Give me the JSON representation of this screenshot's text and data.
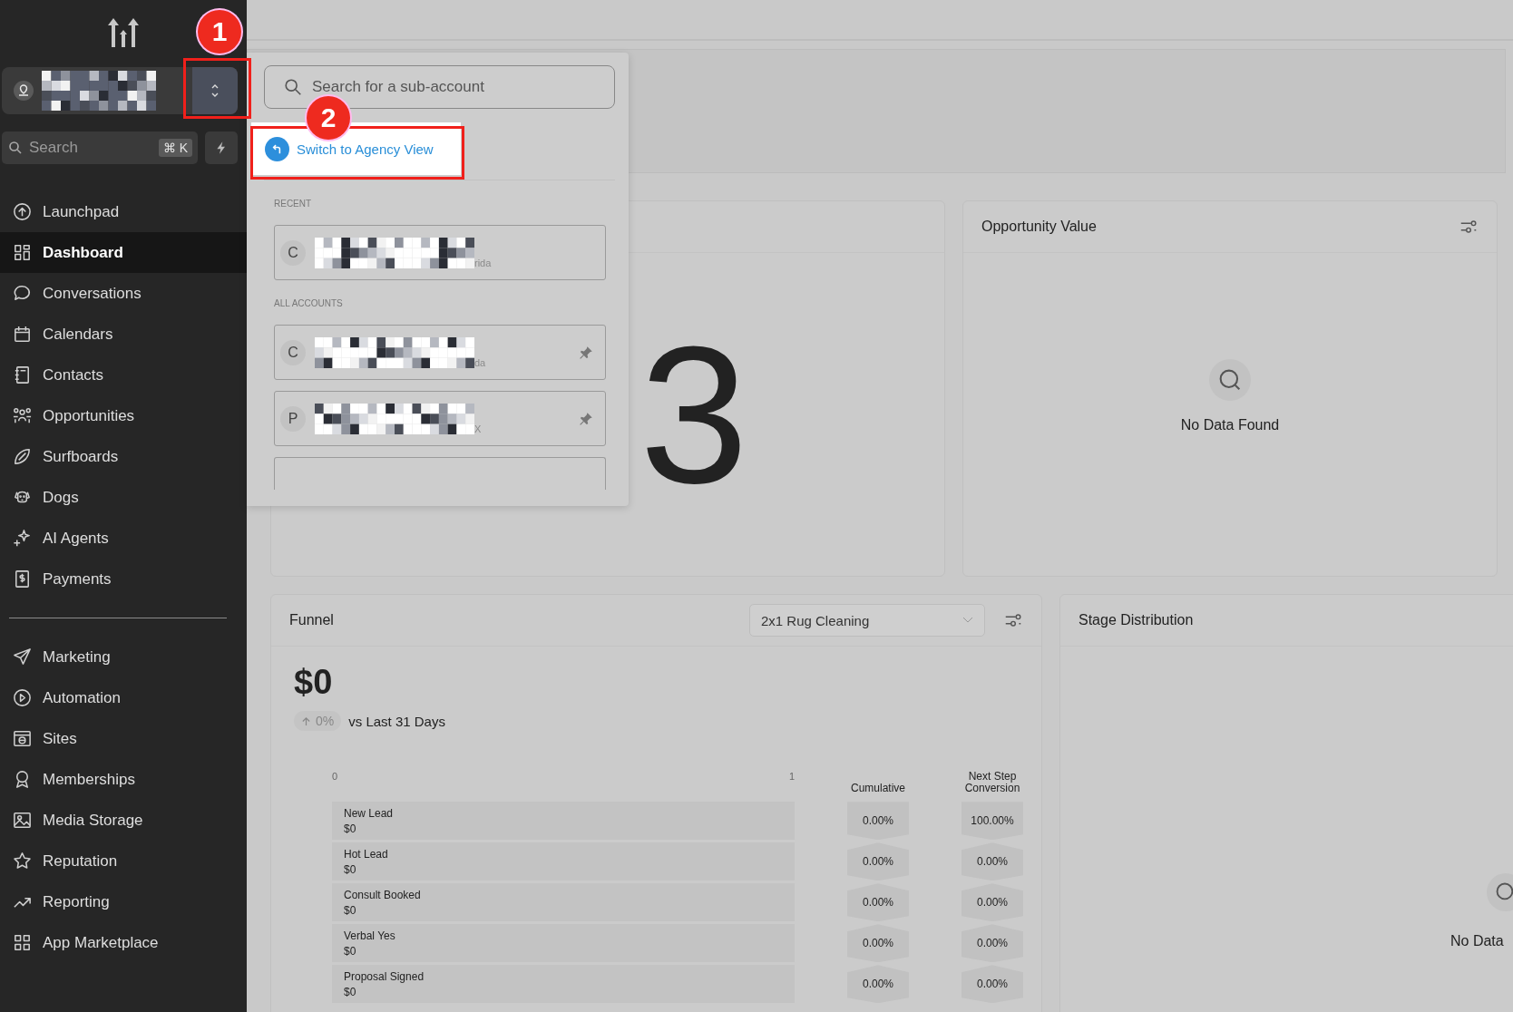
{
  "sidebar": {
    "search": {
      "placeholder": "Search",
      "shortcut": "⌘ K"
    },
    "nav_groups": [
      [
        {
          "label": "Launchpad",
          "selected": false
        },
        {
          "label": "Dashboard",
          "selected": true
        },
        {
          "label": "Conversations",
          "selected": false
        },
        {
          "label": "Calendars",
          "selected": false
        },
        {
          "label": "Contacts",
          "selected": false
        },
        {
          "label": "Opportunities",
          "selected": false
        },
        {
          "label": "Surfboards",
          "selected": false
        },
        {
          "label": "Dogs",
          "selected": false
        },
        {
          "label": "AI Agents",
          "selected": false
        },
        {
          "label": "Payments",
          "selected": false
        }
      ],
      [
        {
          "label": "Marketing",
          "selected": false
        },
        {
          "label": "Automation",
          "selected": false
        },
        {
          "label": "Sites",
          "selected": false
        },
        {
          "label": "Memberships",
          "selected": false
        },
        {
          "label": "Media Storage",
          "selected": false
        },
        {
          "label": "Reputation",
          "selected": false
        },
        {
          "label": "Reporting",
          "selected": false
        },
        {
          "label": "App Marketplace",
          "selected": false
        }
      ]
    ]
  },
  "account_menu": {
    "search": {
      "placeholder": "Search for a sub-account"
    },
    "agency_link": "Switch to Agency View",
    "sections": [
      {
        "heading": "RECENT",
        "accounts": [
          {
            "avatar": "C",
            "detail": "rida",
            "pinnable": false
          }
        ]
      },
      {
        "heading": "ALL ACCOUNTS",
        "accounts": [
          {
            "avatar": "C",
            "detail": "da",
            "pinnable": true
          },
          {
            "avatar": "P",
            "detail": "X",
            "pinnable": true
          }
        ]
      }
    ]
  },
  "cards": {
    "count_card": {
      "value": "3"
    },
    "opportunity_value": {
      "title": "Opportunity Value",
      "empty": "No Data Found"
    },
    "funnel": {
      "title": "Funnel",
      "pipeline": "2x1 Rug Cleaning",
      "total": "$0",
      "change": "0%",
      "comparison": "vs Last 31 Days",
      "axis_ticks": [
        "0",
        "1"
      ],
      "columns": [
        "Cumulative",
        "Next Step Conversion"
      ],
      "stages": [
        {
          "name": "New Lead",
          "value": "$0",
          "cumulative": "0.00%",
          "next_step": "100.00%"
        },
        {
          "name": "Hot Lead",
          "value": "$0",
          "cumulative": "0.00%",
          "next_step": "0.00%"
        },
        {
          "name": "Consult Booked",
          "value": "$0",
          "cumulative": "0.00%",
          "next_step": "0.00%"
        },
        {
          "name": "Verbal Yes",
          "value": "$0",
          "cumulative": "0.00%",
          "next_step": "0.00%"
        },
        {
          "name": "Proposal Signed",
          "value": "$0",
          "cumulative": "0.00%",
          "next_step": "0.00%"
        }
      ]
    },
    "stage_distribution": {
      "title": "Stage Distribution",
      "empty": "No Data"
    }
  },
  "annotations": [
    {
      "label": "1"
    },
    {
      "label": "2"
    }
  ]
}
